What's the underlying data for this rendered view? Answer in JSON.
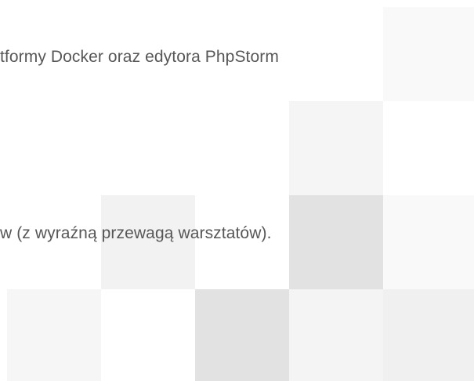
{
  "document": {
    "line_1": "tformy Docker oraz edytora PhpStorm",
    "line_2": "w (z wyraźną przewagą warsztatów)."
  },
  "decor": {
    "tiles": [
      {
        "name": "tile-r0-c4",
        "color": "#f9f9f9"
      },
      {
        "name": "tile-r1-c3",
        "color": "#f5f5f5"
      },
      {
        "name": "tile-r2-c1",
        "color": "#f2f2f2"
      },
      {
        "name": "tile-r2-c3",
        "color": "#e2e2e2"
      },
      {
        "name": "tile-r2-c4",
        "color": "#f9f9f9"
      },
      {
        "name": "tile-r3-c0",
        "color": "#f6f6f6"
      },
      {
        "name": "tile-r3-c2",
        "color": "#e2e2e2"
      },
      {
        "name": "tile-r3-c3",
        "color": "#f4f4f4"
      },
      {
        "name": "tile-r3-c4",
        "color": "#f0f0f0"
      }
    ]
  }
}
